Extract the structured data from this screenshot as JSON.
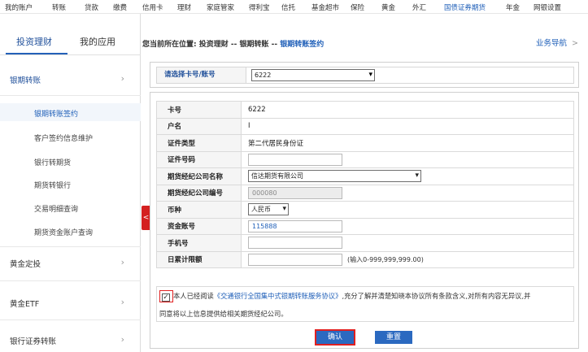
{
  "topnav": {
    "items": [
      "我的账户",
      "转账",
      "贷款",
      "缴费",
      "信用卡",
      "理财",
      "家庭管家",
      "得利宝",
      "信托",
      "基金超市",
      "保险",
      "黄金",
      "外汇",
      "国债证券期货",
      "年金",
      "网银设置"
    ],
    "active_index": 13
  },
  "sidebar": {
    "tabs": [
      "投资理财",
      "我的应用"
    ],
    "groups": [
      {
        "label": "银期转账"
      },
      {
        "label": "黄金定投"
      },
      {
        "label": "黄金ETF"
      },
      {
        "label": "银行证券转账"
      }
    ],
    "subitems": [
      "银期转账签约",
      "客户签约信息维护",
      "银行转期货",
      "期货转银行",
      "交易明细查询",
      "期货资金账户查询"
    ],
    "collapse_glyph": "<"
  },
  "main": {
    "breadcrumb_prefix": "您当前所在位置:  投资理财 -- 银期转账 -- ",
    "breadcrumb_current": "银期转账签约",
    "biz_guide": "业务导航",
    "biz_guide_arrow": ">",
    "card_select_label": "请选择卡号/账号",
    "card_select_value": "6222",
    "form": {
      "card_no_label": "卡号",
      "card_no_value": "6222",
      "name_label": "户名",
      "name_value": "I",
      "id_type_label": "证件类型",
      "id_type_value": "第二代居民身份证",
      "id_no_label": "证件号码",
      "id_no_value": "",
      "company_label": "期货经纪公司名称",
      "company_value": "信达期货有限公司",
      "company_no_label": "期货经纪公司编号",
      "company_no_value": "000080",
      "currency_label": "币种",
      "currency_value": "人民币",
      "fund_acct_label": "资金账号",
      "fund_acct_value": "115888",
      "mobile_label": "手机号",
      "mobile_value": "",
      "limit_label": "日累计限额",
      "limit_value": "",
      "limit_hint": "(输入0-999,999,999.00)"
    },
    "agreement": {
      "checked": "✓",
      "text_a": "本人已经阅读",
      "link": "《交通银行全国集中式银期转账服务协议》",
      "text_b": ",充分了解并清楚知晓本协议所有条款含义,对所有内容无异议,并",
      "text_c": "同意将以上信息提供给相关期货经纪公司。"
    },
    "buttons": {
      "confirm": "确认",
      "reset": "重置"
    }
  }
}
